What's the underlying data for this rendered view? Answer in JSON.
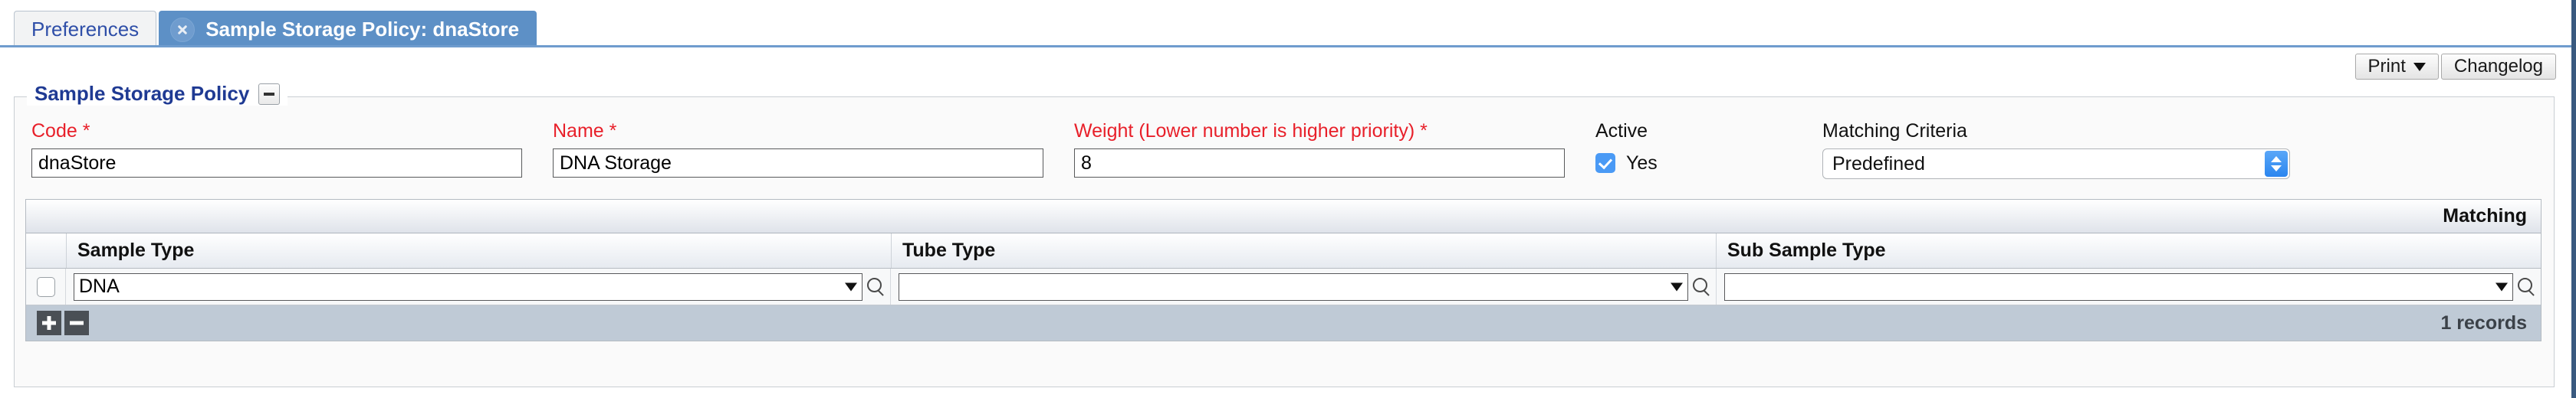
{
  "tabs": [
    {
      "label": "Preferences",
      "active": false,
      "closable": false
    },
    {
      "label": "Sample Storage Policy: dnaStore",
      "active": true,
      "closable": true
    }
  ],
  "toolbar": {
    "print_label": "Print",
    "changelog_label": "Changelog"
  },
  "panel": {
    "legend": "Sample Storage Policy",
    "collapse_icon": "minus-icon"
  },
  "form": {
    "code": {
      "label": "Code *",
      "value": "dnaStore",
      "placeholder": ""
    },
    "name": {
      "label": "Name *",
      "value": "DNA Storage",
      "placeholder": ""
    },
    "weight": {
      "label": "Weight (Lower number is higher priority) *",
      "value": "8",
      "placeholder": ""
    },
    "active": {
      "label": "Active",
      "checked_label": "Yes",
      "checked": true
    },
    "matching_criteria": {
      "label": "Matching Criteria",
      "value": "Predefined",
      "options": [
        "Predefined"
      ]
    }
  },
  "grid": {
    "toolbar_label": "Matching",
    "columns": [
      "Sample Type",
      "Tube Type",
      "Sub Sample Type"
    ],
    "rows": [
      {
        "selected": false,
        "sample_type": "DNA",
        "tube_type": "",
        "sub_sample_type": ""
      }
    ],
    "footer": {
      "add_icon": "plus-icon",
      "remove_icon": "minus-icon",
      "records_label": "1 records"
    }
  },
  "colors": {
    "active_tab_bg": "#5d90c6",
    "tab_link": "#2f4fa8",
    "legend": "#1f3a93",
    "required_label": "#e8202a",
    "checkbox_on": "#4a9af5",
    "grid_footer": "#bfcad6",
    "frame_right": "#3a5a80"
  }
}
